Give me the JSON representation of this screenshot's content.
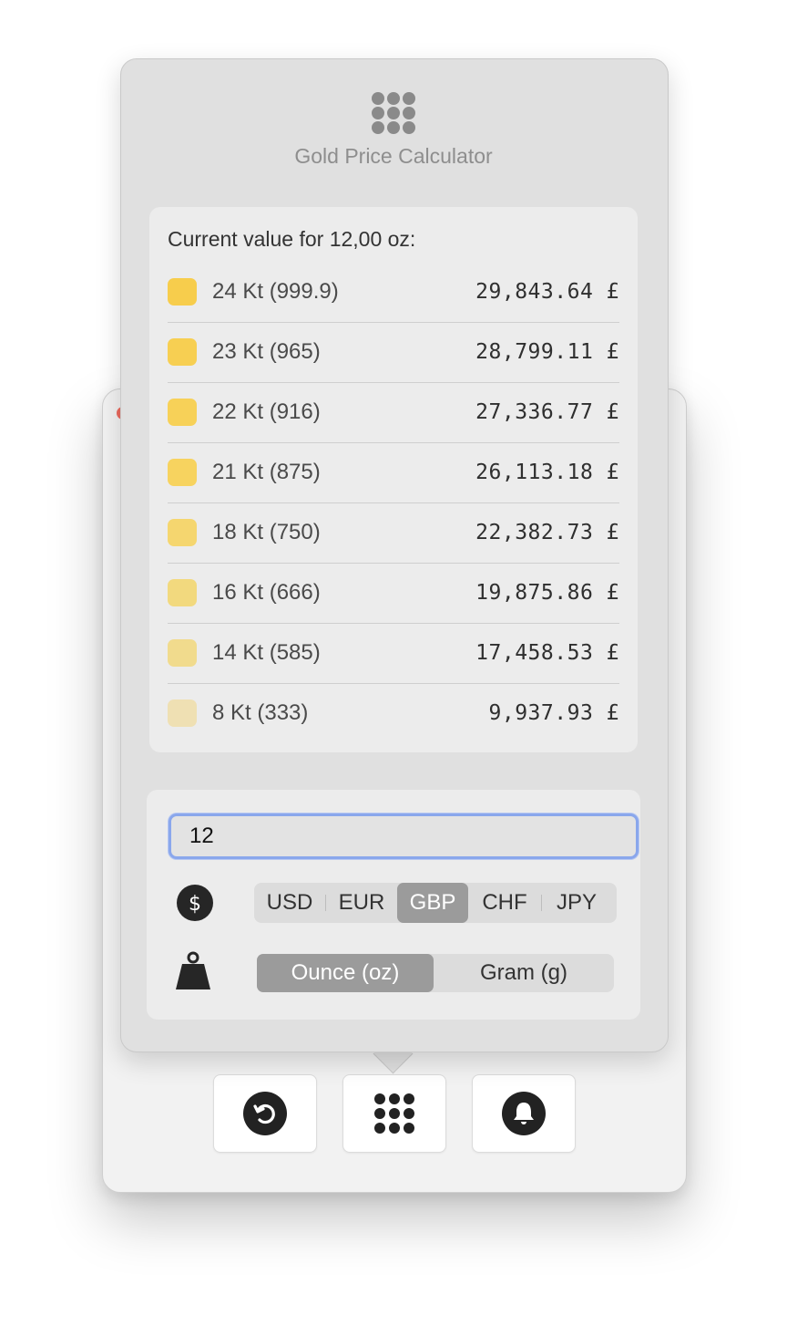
{
  "app": {
    "title": "Gold Price Calculator",
    "icon": "keypad-icon"
  },
  "results": {
    "heading": "Current value for 12,00 oz:",
    "rows": [
      {
        "karat": "24 Kt (999.9)",
        "value": "29,843.64 £",
        "color": "#f7cd4c"
      },
      {
        "karat": "23 Kt (965)",
        "value": "28,799.11 £",
        "color": "#f7cf52"
      },
      {
        "karat": "22 Kt (916)",
        "value": "27,336.77 £",
        "color": "#f7d158"
      },
      {
        "karat": "21 Kt (875)",
        "value": "26,113.18 £",
        "color": "#f7d35f"
      },
      {
        "karat": "18 Kt (750)",
        "value": "22,382.73 £",
        "color": "#f5d66f"
      },
      {
        "karat": "16 Kt (666)",
        "value": "19,875.86 £",
        "color": "#f2d97e"
      },
      {
        "karat": "14 Kt (585)",
        "value": "17,458.53 £",
        "color": "#f1db8d"
      },
      {
        "karat": "8 Kt (333)",
        "value": "9,937.93 £",
        "color": "#efe0b3"
      }
    ]
  },
  "settings": {
    "amount_value": "12",
    "currency_icon": "dollar-circle-icon",
    "currencies": [
      "USD",
      "EUR",
      "GBP",
      "CHF",
      "JPY"
    ],
    "selected_currency": "GBP",
    "unit_icon": "weight-icon",
    "units": [
      "Ounce (oz)",
      "Gram (g)"
    ],
    "selected_unit": "Ounce (oz)"
  },
  "toolbar": {
    "buttons": [
      "refresh-icon",
      "keypad-icon",
      "bell-icon"
    ]
  },
  "colors": {
    "accent_focus": "#8aa7ec",
    "selected_segment": "#9b9b9b"
  }
}
